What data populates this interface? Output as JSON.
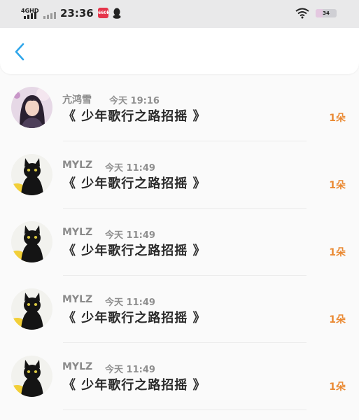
{
  "status_bar": {
    "network": "4GHD",
    "time": "23:36",
    "app_badge": "660k",
    "battery": "34",
    "battery_level": 0.34
  },
  "header": {
    "back_icon": "chevron-left-icon"
  },
  "items": [
    {
      "name": "亢鸿雪",
      "time": "今天 19:16",
      "song": "《 少年歌行之路招摇 》",
      "count": "1朵",
      "avatar": "girl-photo"
    },
    {
      "name": "MYLZ",
      "time": "今天 11:49",
      "song": "《 少年歌行之路招摇 》",
      "count": "1朵",
      "avatar": "black-cat"
    },
    {
      "name": "MYLZ",
      "time": "今天 11:49",
      "song": "《 少年歌行之路招摇 》",
      "count": "1朵",
      "avatar": "black-cat"
    },
    {
      "name": "MYLZ",
      "time": "今天 11:49",
      "song": "《 少年歌行之路招摇 》",
      "count": "1朵",
      "avatar": "black-cat"
    },
    {
      "name": "MYLZ",
      "time": "今天 11:49",
      "song": "《 少年歌行之路招摇 》",
      "count": "1朵",
      "avatar": "black-cat"
    }
  ],
  "colors": {
    "accent_back": "#2fa6ea",
    "count": "#ea8a34",
    "status_bar_bg": "#e9e9ea"
  }
}
